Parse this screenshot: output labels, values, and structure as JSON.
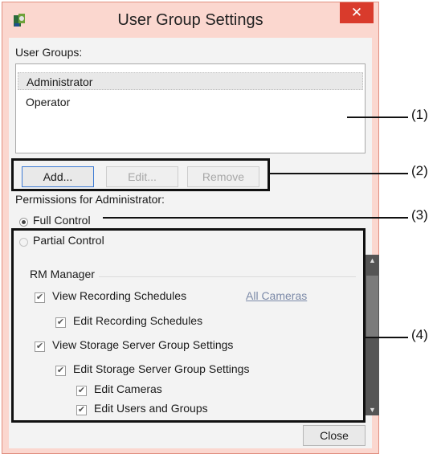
{
  "window": {
    "title": "User Group Settings",
    "close_glyph": "✕"
  },
  "user_groups": {
    "label": "User Groups:",
    "items": [
      "Administrator",
      "Operator"
    ],
    "selected": "Administrator"
  },
  "buttons": {
    "add": "Add...",
    "edit": "Edit...",
    "remove": "Remove",
    "close": "Close"
  },
  "permissions": {
    "label": "Permissions for Administrator:",
    "full_control": "Full Control",
    "partial_control": "Partial Control",
    "selected_mode": "Full Control",
    "group_title": "RM Manager",
    "items": [
      "View Recording Schedules",
      "Edit Recording Schedules",
      "View Storage Server Group Settings",
      "Edit Storage Server Group Settings",
      "Edit Cameras",
      "Edit Users and Groups"
    ],
    "all_cameras_link": "All Cameras"
  },
  "icons": {
    "app": "camera-app-icon",
    "close": "close-icon",
    "check": "checkmark-icon",
    "scroll_up": "scroll-up-arrow-icon",
    "scroll_down": "scroll-down-arrow-icon"
  },
  "callouts": [
    "(1)",
    "(2)",
    "(3)",
    "(4)"
  ]
}
